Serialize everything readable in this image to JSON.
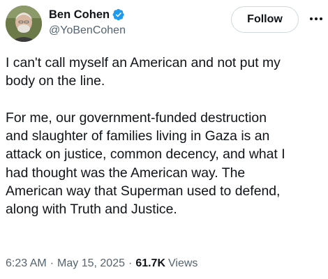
{
  "author": {
    "display_name": "Ben Cohen",
    "handle": "@YoBenCohen",
    "verified_color": "#1d9bf0",
    "avatar_icon": "profile-photo"
  },
  "actions": {
    "follow_label": "Follow",
    "more_icon": "more-horizontal-icon"
  },
  "tweet": {
    "paragraph1_lines": [
      "I can't call myself an American and not put my",
      "body on the line."
    ],
    "paragraph2_lines": [
      "For me, our government-funded destruction",
      "and slaughter of families living in Gaza is an",
      "attack on justice, common decency, and what I",
      "had thought was the American way. The",
      "American way that Superman used to defend,",
      "along with Truth and Justice."
    ]
  },
  "meta": {
    "time": "6:23 AM",
    "separator": "·",
    "date": "May 15, 2025",
    "views_count": "61.7K",
    "views_label": "Views"
  }
}
